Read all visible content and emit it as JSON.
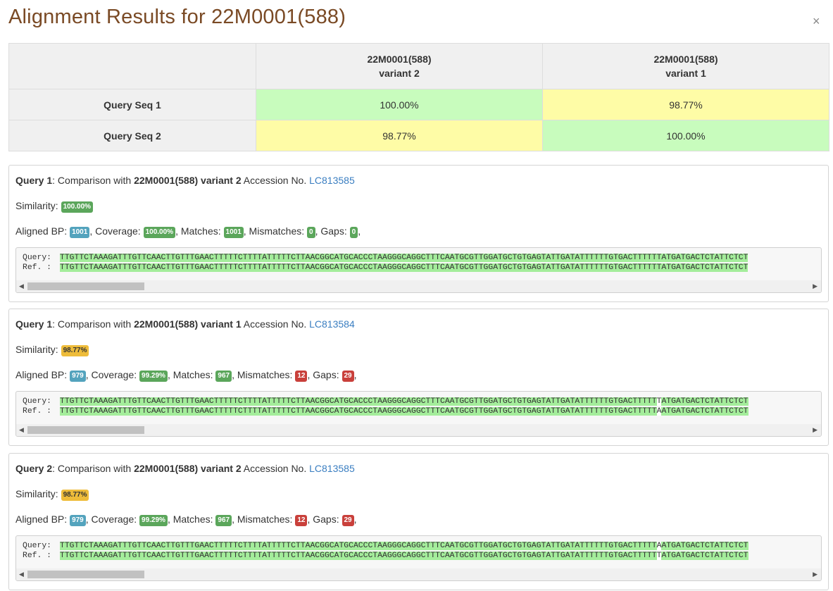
{
  "title": "Alignment Results for 22M0001(588)",
  "close_label": "×",
  "summary": {
    "col1_name": "22M0001(588)",
    "col1_variant": "variant 2",
    "col2_name": "22M0001(588)",
    "col2_variant": "variant 1",
    "rows": [
      {
        "label": "Query Seq 1",
        "v1": "100.00%",
        "v2": "98.77%"
      },
      {
        "label": "Query Seq 2",
        "v1": "98.77%",
        "v2": "100.00%"
      }
    ]
  },
  "colors": {
    "match_bg": "#c8fcbd",
    "partial_bg": "#fefca6",
    "title": "#7a4a25"
  },
  "panels": [
    {
      "query": "Query 1",
      "comparison_text": ": Comparison with ",
      "target": "22M0001(588) variant 2",
      "accession_text": " Accession No. ",
      "accession": "LC813585",
      "similarity_label": "Similarity: ",
      "similarity": "100.00%",
      "aligned_label": "Aligned BP: ",
      "aligned": "1001",
      "coverage_label": ", Coverage: ",
      "coverage": "100.00%",
      "matches_label": ", Matches: ",
      "matches": "1001",
      "mismatches_label": ", Mismatches: ",
      "mismatches": "0",
      "gaps_label": ", Gaps: ",
      "gaps": "0",
      "tail": ",",
      "query_label": "Query:",
      "ref_label": "Ref. :",
      "query_seq_a": "TTGTTCTAAAGATTTGTTCAACTTGTTTGAACTTTTTCTTTTATTTTTCTTAACGGCATGCACCCTAAGGGCAGGCTTTCAATGCGTTGGATGCTGTGAGTATTGATATTTTTTGTGACTTTTTTATGATGACTCTATTCTCT",
      "query_seq_mm": "",
      "query_seq_b": "",
      "ref_seq_a": "TTGTTCTAAAGATTTGTTCAACTTGTTTGAACTTTTTCTTTTATTTTTCTTAACGGCATGCACCCTAAGGGCAGGCTTTCAATGCGTTGGATGCTGTGAGTATTGATATTTTTTGTGACTTTTTTATGATGACTCTATTCTCT",
      "ref_seq_mm": "",
      "ref_seq_b": ""
    },
    {
      "query": "Query 1",
      "comparison_text": ": Comparison with ",
      "target": "22M0001(588) variant 1",
      "accession_text": " Accession No. ",
      "accession": "LC813584",
      "similarity_label": "Similarity: ",
      "similarity": "98.77%",
      "aligned_label": "Aligned BP: ",
      "aligned": "979",
      "coverage_label": ", Coverage: ",
      "coverage": "99.29%",
      "matches_label": ", Matches: ",
      "matches": "967",
      "mismatches_label": ", Mismatches: ",
      "mismatches": "12",
      "gaps_label": ", Gaps: ",
      "gaps": "29",
      "tail": ",",
      "query_label": "Query:",
      "ref_label": "Ref. :",
      "query_seq_a": "TTGTTCTAAAGATTTGTTCAACTTGTTTGAACTTTTTCTTTTATTTTTCTTAACGGCATGCACCCTAAGGGCAGGCTTTCAATGCGTTGGATGCTGTGAGTATTGATATTTTTTGTGACTTTTT",
      "query_seq_mm": "T",
      "query_seq_b": "ATGATGACTCTATTCTCT",
      "ref_seq_a": "TTGTTCTAAAGATTTGTTCAACTTGTTTGAACTTTTTCTTTTATTTTTCTTAACGGCATGCACCCTAAGGGCAGGCTTTCAATGCGTTGGATGCTGTGAGTATTGATATTTTTTGTGACTTTTT",
      "ref_seq_mm": "A",
      "ref_seq_b": "ATGATGACTCTATTCTCT"
    },
    {
      "query": "Query 2",
      "comparison_text": ": Comparison with ",
      "target": "22M0001(588) variant 2",
      "accession_text": " Accession No. ",
      "accession": "LC813585",
      "similarity_label": "Similarity: ",
      "similarity": "98.77%",
      "aligned_label": "Aligned BP: ",
      "aligned": "979",
      "coverage_label": ", Coverage: ",
      "coverage": "99.29%",
      "matches_label": ", Matches: ",
      "matches": "967",
      "mismatches_label": ", Mismatches: ",
      "mismatches": "12",
      "gaps_label": ", Gaps: ",
      "gaps": "29",
      "tail": ",",
      "query_label": "Query:",
      "ref_label": "Ref. :",
      "query_seq_a": "TTGTTCTAAAGATTTGTTCAACTTGTTTGAACTTTTTCTTTTATTTTTCTTAACGGCATGCACCCTAAGGGCAGGCTTTCAATGCGTTGGATGCTGTGAGTATTGATATTTTTTGTGACTTTTT",
      "query_seq_mm": "A",
      "query_seq_b": "ATGATGACTCTATTCTCT",
      "ref_seq_a": "TTGTTCTAAAGATTTGTTCAACTTGTTTGAACTTTTTCTTTTATTTTTCTTAACGGCATGCACCCTAAGGGCAGGCTTTCAATGCGTTGGATGCTGTGAGTATTGATATTTTTTGTGACTTTTT",
      "ref_seq_mm": "T",
      "ref_seq_b": "ATGATGACTCTATTCTCT"
    }
  ]
}
